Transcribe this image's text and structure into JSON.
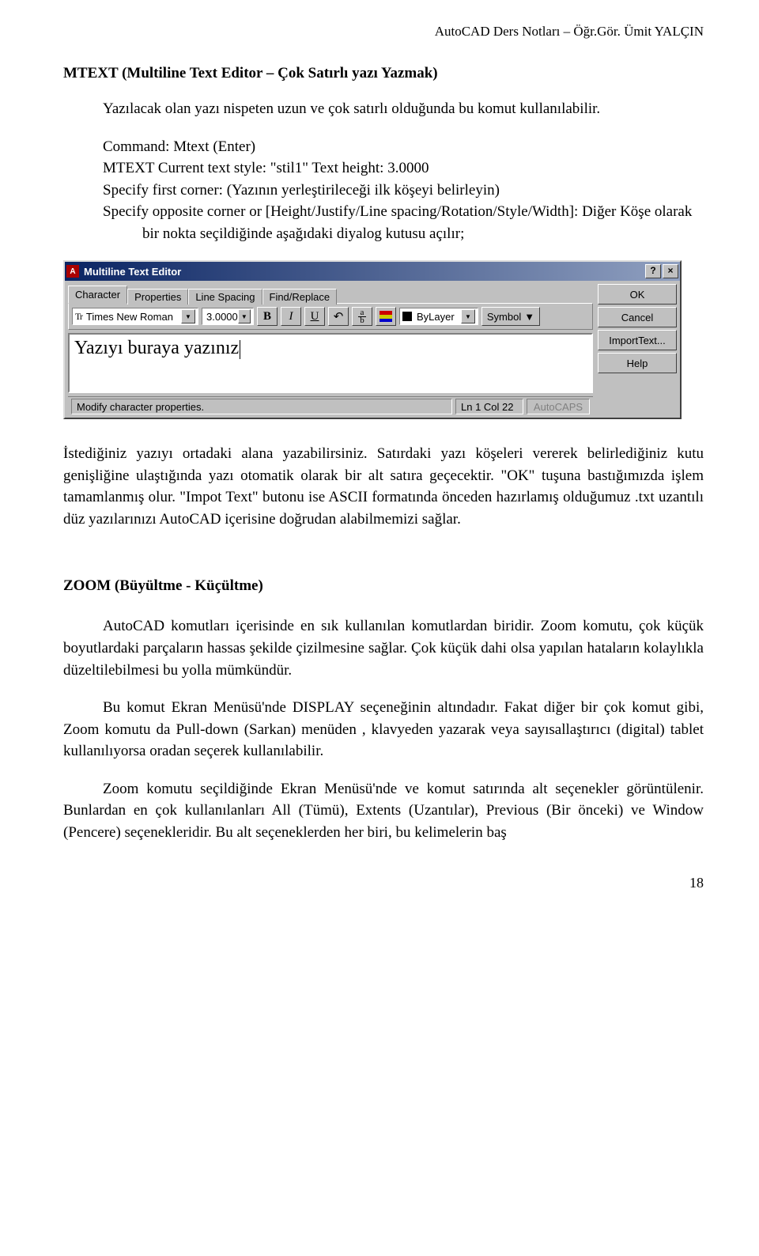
{
  "header": {
    "right": "AutoCAD Ders Notları – Öğr.Gör. Ümit YALÇIN"
  },
  "sectionA": {
    "title": "MTEXT  (Multiline Text Editor – Çok Satırlı yazı Yazmak)",
    "intro": "Yazılacak olan yazı nispeten uzun ve çok satırlı olduğunda bu komut kullanılabilir.",
    "cmd1": "Command: Mtext (Enter)",
    "cmd2": "MTEXT Current text style:  \"stil1\"   Text height:  3.0000",
    "cmd3": "Specify first corner:   (Yazının yerleştirileceği ilk köşeyi belirleyin)",
    "cmd4": "Specify opposite corner or [Height/Justify/Line spacing/Rotation/Style/Width]: Diğer Köşe olarak bir nokta seçildiğinde aşağıdaki diyalog kutusu açılır;"
  },
  "dialog": {
    "title": "Multiline Text Editor",
    "tabs": [
      "Character",
      "Properties",
      "Line Spacing",
      "Find/Replace"
    ],
    "font": "Times New Roman",
    "height": "3.0000",
    "bold": "B",
    "italic": "I",
    "underline": "U",
    "undo_tip": "↶",
    "stack_a": "a",
    "stack_b": "b",
    "layer": "ByLayer",
    "symbol": "Symbol",
    "ok": "OK",
    "cancel": "Cancel",
    "import": "ImportText...",
    "help": "Help",
    "text_value": "Yazıyı buraya yazınız",
    "status_msg": "Modify character properties.",
    "status_pos": "Ln 1 Col 22",
    "status_auto": "AutoCAPS",
    "help_glyph": "?",
    "close_glyph": "×",
    "chev": "▼"
  },
  "sectionA_after": "İstediğiniz yazıyı ortadaki alana yazabilirsiniz. Satırdaki yazı köşeleri vererek belirlediğiniz kutu genişliğine ulaştığında yazı otomatik olarak bir alt satıra geçecektir. \"OK\" tuşuna bastığımızda işlem tamamlanmış olur. \"Impot Text\" butonu ise ASCII formatında önceden hazırlamış olduğumuz .txt uzantılı düz yazılarınızı AutoCAD içerisine doğrudan alabilmemizi sağlar.",
  "sectionB": {
    "title": "ZOOM (Büyültme - Küçültme)",
    "p1": "AutoCAD komutları içerisinde en sık kullanılan komutlardan biridir. Zoom komutu, çok küçük boyutlardaki parçaların hassas şekilde çizilmesine sağlar. Çok küçük dahi olsa yapılan hataların kolaylıkla düzeltilebilmesi bu yolla mümkündür.",
    "p2": "Bu komut Ekran Menüsü'nde DISPLAY seçeneğinin altındadır. Fakat diğer bir çok komut gibi, Zoom komutu da Pull-down (Sarkan) menüden , klavyeden yazarak veya sayısallaştırıcı (digital) tablet kullanılıyorsa oradan seçerek kullanılabilir.",
    "p3": "Zoom komutu seçildiğinde Ekran Menüsü'nde ve komut satırında alt seçenekler görüntülenir. Bunlardan en çok kullanılanları All (Tümü), Extents (Uzantılar), Previous (Bir önceki) ve Window (Pencere) seçenekleridir. Bu alt seçeneklerden her biri, bu kelimelerin baş"
  },
  "page_number": "18"
}
